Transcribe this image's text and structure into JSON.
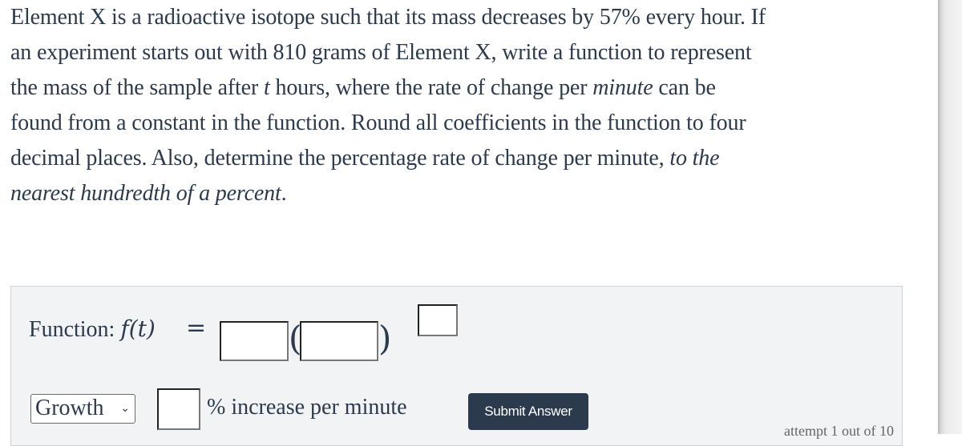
{
  "question": {
    "lines": [
      [
        {
          "t": "Element X is a radioactive isotope such that its mass decreases by 57% every hour. If"
        }
      ],
      [
        {
          "t": "an experiment starts out with 810 grams of Element X, write a function to represent"
        }
      ],
      [
        {
          "t": "the mass of the sample after "
        },
        {
          "t": "t",
          "i": true
        },
        {
          "t": " hours, where the rate of change per "
        },
        {
          "t": "minute",
          "i": true
        },
        {
          "t": " can be"
        }
      ],
      [
        {
          "t": "found from a constant in the function. Round all coefficients in the function to four"
        }
      ],
      [
        {
          "t": "decimal places. Also, determine the percentage rate of change per minute, "
        },
        {
          "t": "to the",
          "i": true
        }
      ],
      [
        {
          "t": "nearest hundredth of a percent",
          "i": true
        },
        {
          "t": "."
        }
      ]
    ]
  },
  "answer_panel": {
    "function_label": "Function:",
    "function_math": "f(t)",
    "equals": "=",
    "coefficient_value": "",
    "base_value": "",
    "exponent_value": "",
    "rate_type_selected": "Growth",
    "rate_value": "",
    "rate_suffix": "% increase per minute",
    "submit_label": "Submit Answer",
    "attempt_text": "attempt 1 out of 10"
  },
  "colors": {
    "text": "#2b3a4d",
    "panel_bg": "#f2f3f5",
    "button_bg": "#2b3a4d"
  }
}
